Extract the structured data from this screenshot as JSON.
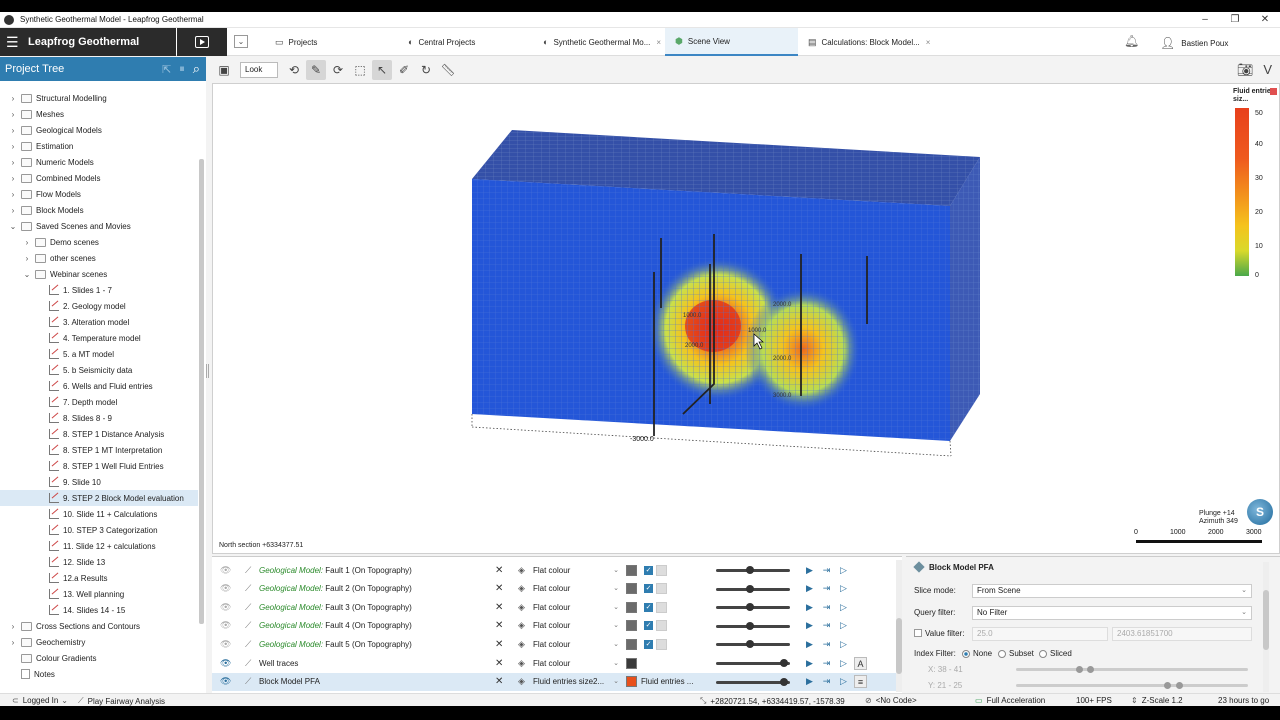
{
  "window": {
    "title": "Synthetic Geothermal Model - Leapfrog Geothermal"
  },
  "header": {
    "brand": "Leapfrog Geothermal",
    "tabs": [
      {
        "label": "Projects",
        "icon": "folder-icon"
      },
      {
        "label": "Central Projects",
        "icon": "central-icon"
      },
      {
        "label": "Synthetic Geothermal Mo...",
        "icon": "project-icon",
        "close": "×"
      },
      {
        "label": "Scene View",
        "icon": "cube-icon"
      },
      {
        "label": "Calculations: Block Model...",
        "icon": "calc-icon",
        "close": "×"
      }
    ],
    "user": "Bastien Poux"
  },
  "tree": {
    "title": "Project Tree",
    "items": [
      {
        "label": "Structural Modelling",
        "level": 0,
        "kind": "folder",
        "expand": "closed"
      },
      {
        "label": "Meshes",
        "level": 0,
        "kind": "folder",
        "expand": "closed"
      },
      {
        "label": "Geological Models",
        "level": 0,
        "kind": "folder",
        "expand": "closed"
      },
      {
        "label": "Estimation",
        "level": 0,
        "kind": "folder",
        "expand": "closed"
      },
      {
        "label": "Numeric Models",
        "level": 0,
        "kind": "folder",
        "expand": "closed"
      },
      {
        "label": "Combined Models",
        "level": 0,
        "kind": "folder",
        "expand": "closed"
      },
      {
        "label": "Flow Models",
        "level": 0,
        "kind": "folder",
        "expand": "closed"
      },
      {
        "label": "Block Models",
        "level": 0,
        "kind": "folder",
        "expand": "closed"
      },
      {
        "label": "Saved Scenes and Movies",
        "level": 0,
        "kind": "folder",
        "expand": "open"
      },
      {
        "label": "Demo scenes",
        "level": 1,
        "kind": "folder",
        "expand": "closed"
      },
      {
        "label": "other scenes",
        "level": 1,
        "kind": "folder",
        "expand": "closed"
      },
      {
        "label": "Webinar scenes",
        "level": 1,
        "kind": "folder",
        "expand": "open"
      },
      {
        "label": "1. Slides 1 - 7",
        "level": 2,
        "kind": "scene"
      },
      {
        "label": "2. Geology model",
        "level": 2,
        "kind": "scene"
      },
      {
        "label": "3. Alteration model",
        "level": 2,
        "kind": "scene"
      },
      {
        "label": "4. Temperature model",
        "level": 2,
        "kind": "scene"
      },
      {
        "label": "5. a MT model",
        "level": 2,
        "kind": "scene"
      },
      {
        "label": "5. b Seismicity data",
        "level": 2,
        "kind": "scene"
      },
      {
        "label": "6. Wells and Fluid entries",
        "level": 2,
        "kind": "scene"
      },
      {
        "label": "7. Depth model",
        "level": 2,
        "kind": "scene"
      },
      {
        "label": "8. Slides 8 - 9",
        "level": 2,
        "kind": "scene"
      },
      {
        "label": "8. STEP 1 Distance Analysis",
        "level": 2,
        "kind": "scene"
      },
      {
        "label": "8. STEP 1 MT Interpretation",
        "level": 2,
        "kind": "scene"
      },
      {
        "label": "8. STEP 1 Well Fluid Entries",
        "level": 2,
        "kind": "scene"
      },
      {
        "label": "9. Slide 10",
        "level": 2,
        "kind": "scene"
      },
      {
        "label": "9. STEP 2 Block Model evaluation",
        "level": 2,
        "kind": "scene",
        "selected": true
      },
      {
        "label": "10. Slide 11 + Calculations",
        "level": 2,
        "kind": "scene"
      },
      {
        "label": "10. STEP 3 Categorization",
        "level": 2,
        "kind": "scene"
      },
      {
        "label": "11. Slide 12 + calculations",
        "level": 2,
        "kind": "scene"
      },
      {
        "label": "12. Slide 13",
        "level": 2,
        "kind": "scene"
      },
      {
        "label": "12.a Results",
        "level": 2,
        "kind": "scene"
      },
      {
        "label": "13. Well planning",
        "level": 2,
        "kind": "scene"
      },
      {
        "label": "14. Slides 14 - 15",
        "level": 2,
        "kind": "scene"
      },
      {
        "label": "Cross Sections and Contours",
        "level": 0,
        "kind": "folder",
        "expand": "closed"
      },
      {
        "label": "Geochemistry",
        "level": 0,
        "kind": "folder",
        "expand": "closed"
      },
      {
        "label": "Colour Gradients",
        "level": 0,
        "kind": "folder",
        "expand": "none"
      },
      {
        "label": "Notes",
        "level": 0,
        "kind": "note",
        "expand": "none"
      }
    ]
  },
  "toolbar": {
    "look_label": "Look"
  },
  "viewport": {
    "north_section": "North section +6334377.51",
    "orientation": {
      "plunge": "Plunge +14",
      "azimuth": "Azimuth 349"
    },
    "depth_label": "-3000.0",
    "well_labels": [
      "1000.0",
      "2000.0",
      "2000.0",
      "3000.0",
      "1000.0",
      "2000.0"
    ],
    "legend": {
      "title": "Fluid entries siz...",
      "ticks": [
        "50",
        "40",
        "30",
        "20",
        "10",
        "0"
      ]
    },
    "scalebar": [
      "0",
      "1000",
      "2000",
      "3000"
    ]
  },
  "shapes": [
    {
      "prefix": "Geological Model:",
      "name": " Fault 1 (On Topography)",
      "colour": "Flat colour",
      "swatch": "#6b6b6b",
      "visible": false
    },
    {
      "prefix": "Geological Model:",
      "name": " Fault 2 (On Topography)",
      "colour": "Flat colour",
      "swatch": "#6b6b6b",
      "visible": false
    },
    {
      "prefix": "Geological Model:",
      "name": " Fault 3 (On Topography)",
      "colour": "Flat colour",
      "swatch": "#6b6b6b",
      "visible": false
    },
    {
      "prefix": "Geological Model:",
      "name": " Fault 4 (On Topography)",
      "colour": "Flat colour",
      "swatch": "#6b6b6b",
      "visible": false
    },
    {
      "prefix": "Geological Model:",
      "name": " Fault 5 (On Topography)",
      "colour": "Flat colour",
      "swatch": "#6b6b6b",
      "visible": false
    },
    {
      "prefix": "",
      "name": "Well traces",
      "colour": "Flat colour",
      "swatch": "#3a3a3a",
      "visible": true
    },
    {
      "prefix": "",
      "name": "Block Model PFA",
      "colour": "Fluid entries size2...",
      "colour2": "Fluid entries ...",
      "swatch": "#e8501c",
      "visible": true,
      "selected": true
    }
  ],
  "props": {
    "title": "Block Model PFA",
    "slice_mode_label": "Slice mode:",
    "slice_mode_value": "From Scene",
    "query_filter_label": "Query filter:",
    "query_filter_value": "No Filter",
    "value_filter_label": "Value filter:",
    "value_filter_min": "25.0",
    "value_filter_max": "2403.61851700",
    "index_filter_label": "Index Filter:",
    "index_options": [
      "None",
      "Subset",
      "Sliced"
    ],
    "x_range": "X: 38 - 41",
    "y_range": "Y: 21 - 25"
  },
  "status": {
    "logged_in": "Logged In",
    "analysis": "Play Fairway Analysis",
    "coords": "+2820721.54, +6334419.57, -1578.39",
    "code": "<No Code>",
    "accel": "Full Acceleration",
    "fps": "100+ FPS",
    "zscale": "Z-Scale 1.2",
    "time": "23 hours to go"
  },
  "colors": {
    "accent": "#2f7db0",
    "block_blue": "#2456d8",
    "hot": "#e8401c"
  }
}
